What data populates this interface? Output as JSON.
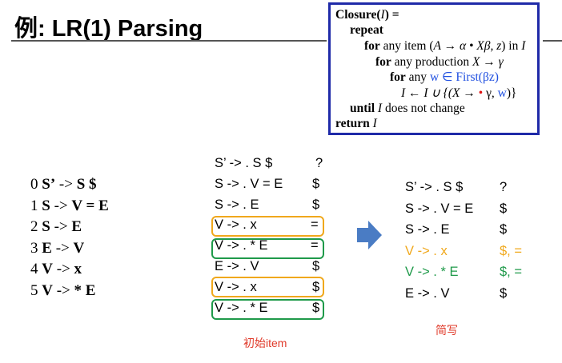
{
  "slide": {
    "title": "例: LR(1) Parsing"
  },
  "closure": {
    "l1a": "Closure(",
    "l1i": "I",
    "l1b": ") =",
    "l2": "repeat",
    "l3kw": "for",
    "l3a": " any item (",
    "l3m": "A → α • Xβ, z",
    "l3b": ") in ",
    "l3i": "I",
    "l4kw": "for",
    "l4a": " any production ",
    "l4m": "X → γ",
    "l5kw": "for",
    "l5a": " any ",
    "l5w": "w ∈ First(βz)",
    "l6a": "I ← I ∪ {(X → ",
    "l6dot": "•",
    "l6b": " γ, ",
    "l6w": "w",
    "l6c": ")}",
    "l7kw": "until",
    "l7a": " ",
    "l7i": "I",
    "l7b": " does not change",
    "l8kw": "return",
    "l8a": " ",
    "l8i": "I"
  },
  "grammar": [
    {
      "n": "0",
      "lhs": "S’",
      "arrow": "->",
      "rhs": "S $"
    },
    {
      "n": "1",
      "lhs": "S",
      "arrow": "->",
      "rhs": "V = E"
    },
    {
      "n": "2",
      "lhs": "S",
      "arrow": "->",
      "rhs": "E"
    },
    {
      "n": "3",
      "lhs": "E",
      "arrow": "->",
      "rhs": "V"
    },
    {
      "n": "4",
      "lhs": "V",
      "arrow": "->",
      "rhs": "x"
    },
    {
      "n": "5",
      "lhs": "V",
      "arrow": "->",
      "rhs": "* E"
    }
  ],
  "initial_items": [
    {
      "prod": "S’ -> . S $",
      "la": "?"
    },
    {
      "prod": "S -> . V = E",
      "la": "$"
    },
    {
      "prod": "S -> . E",
      "la": "$"
    },
    {
      "prod": "V -> . x",
      "la": "="
    },
    {
      "prod": "V -> . * E",
      "la": "="
    },
    {
      "prod": "E -> . V",
      "la": "$"
    },
    {
      "prod": "V -> . x",
      "la": "$"
    },
    {
      "prod": "V -> . * E",
      "la": "$"
    }
  ],
  "simplified_items": [
    {
      "prod": "S’ -> . S $",
      "la": "?"
    },
    {
      "prod": "S -> . V = E",
      "la": "$"
    },
    {
      "prod": "S -> . E",
      "la": "$"
    },
    {
      "prod": "V -> . x",
      "la": "$, ="
    },
    {
      "prod": "V -> . * E",
      "la": "$, ="
    },
    {
      "prod": "E -> . V",
      "la": "$"
    }
  ],
  "labels": {
    "initial": "初始item",
    "simplified": "简写"
  },
  "colors": {
    "closure_border": "#1f2aa8",
    "blue_text": "#1f4fe0",
    "orange": "#f0a81c",
    "green": "#1f9a4a",
    "arrow": "#4a7cc4",
    "note": "#e03a2a",
    "dot": "#e01515"
  }
}
